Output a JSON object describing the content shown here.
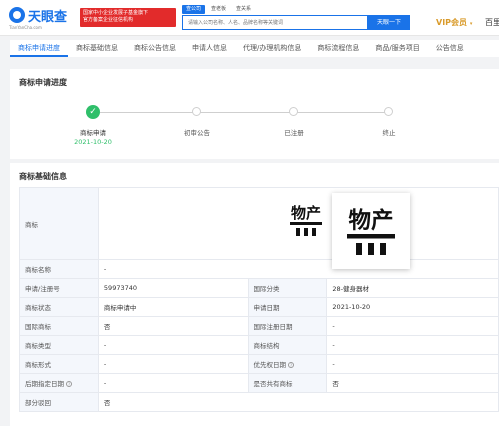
{
  "header": {
    "logo_text": "天眼查",
    "logo_sub": "TianYanCha.com",
    "promo_line1": "国家中小企业发展子基金旗下",
    "promo_line2": "官方备案企业征信机构",
    "search_tabs": [
      "查公司",
      "查老板",
      "查关系"
    ],
    "search_placeholder": "请输入公司名称、人名、品牌名称等关键词",
    "search_button": "天眼一下",
    "vip_label": "VIP会员",
    "user_label": "百里"
  },
  "tabs": [
    "商标申请进度",
    "商标基础信息",
    "商标公告信息",
    "申请人信息",
    "代理/办理机构信息",
    "商标流程信息",
    "商品/服务项目",
    "公告信息"
  ],
  "progress": {
    "title": "商标申请进度",
    "steps": [
      {
        "label": "商标申请",
        "date": "2021-10-20",
        "done": true
      },
      {
        "label": "初审公告",
        "date": "",
        "done": false
      },
      {
        "label": "已注册",
        "date": "",
        "done": false
      },
      {
        "label": "终止",
        "date": "",
        "done": false
      }
    ]
  },
  "basic": {
    "title": "商标基础信息",
    "trademark_label": "商标",
    "trademark_mark_text": "物产",
    "rows": [
      {
        "l1": "商标名称",
        "v1": "-",
        "l2": "",
        "v2": ""
      },
      {
        "l1": "申请/注册号",
        "v1": "59973740",
        "l2": "国际分类",
        "v2": "28-健身器材"
      },
      {
        "l1": "商标状态",
        "v1": "商标申请中",
        "l2": "申请日期",
        "v2": "2021-10-20"
      },
      {
        "l1": "国际商标",
        "v1": "否",
        "l2": "国际注册日期",
        "v2": "-"
      },
      {
        "l1": "商标类型",
        "v1": "-",
        "l2": "商标结构",
        "v2": "-"
      },
      {
        "l1": "商标形式",
        "v1": "-",
        "l2": "优先权日期",
        "v2": "-"
      },
      {
        "l1": "后期指定日期",
        "v1": "-",
        "l2": "是否共有商标",
        "v2": "否"
      },
      {
        "l1": "部分驳回",
        "v1": "否",
        "l2": "",
        "v2": ""
      }
    ]
  }
}
